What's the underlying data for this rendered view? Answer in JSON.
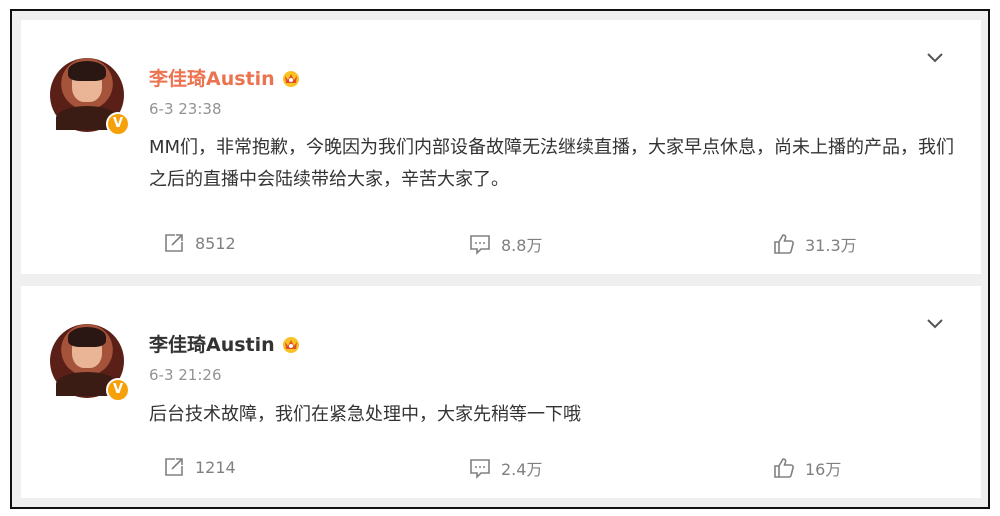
{
  "posts": [
    {
      "author": "李佳琦Austin",
      "timestamp": "6-3 23:38",
      "text": "MM们，非常抱歉，今晚因为我们内部设备故障无法继续直播，大家早点休息，尚未上播的产品，我们之后的直播中会陆续带给大家，辛苦大家了。",
      "reposts": "8512",
      "comments": "8.8万",
      "likes": "31.3万"
    },
    {
      "author": "李佳琦Austin",
      "timestamp": "6-3 21:26",
      "text": "后台技术故障，我们在紧急处理中，大家先稍等一下哦",
      "reposts": "1214",
      "comments": "2.4万",
      "likes": "16万"
    }
  ],
  "colors": {
    "author_highlight": "#eb7350",
    "author_default": "#333333",
    "verified_badge": "#f7a10a",
    "meta_gray": "#939393"
  },
  "icons": {
    "verified": "verified-v-icon",
    "crown": "crown-member-icon",
    "more": "chevron-down-icon",
    "repost": "repost-icon",
    "comment": "comment-icon",
    "like": "thumbs-up-icon"
  }
}
